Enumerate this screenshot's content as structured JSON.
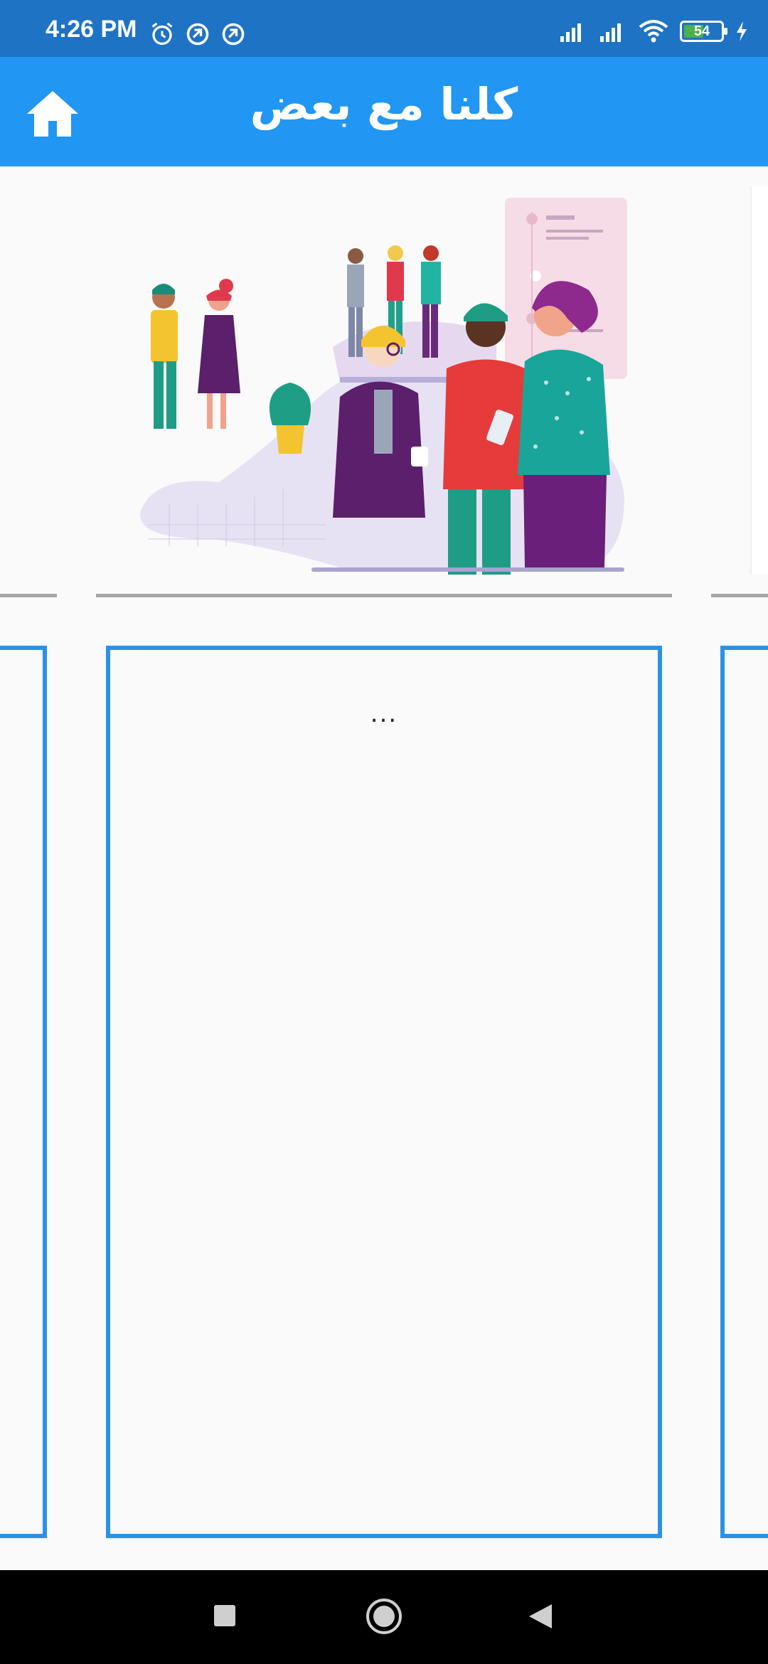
{
  "status_bar": {
    "time": "4:26 PM",
    "battery_level": "54",
    "battery_fraction": 0.54,
    "icons": [
      "alarm-icon",
      "sync-icon",
      "sync-icon",
      "signal-icon",
      "signal-icon",
      "wifi-icon",
      "battery-icon",
      "charging-icon"
    ]
  },
  "app_bar": {
    "title": "كلنا مع بعض",
    "home_icon": "home-icon"
  },
  "carousel": {
    "hero_image": "people-socializing-illustration",
    "center_card": {
      "text": "..."
    }
  },
  "nav_bar": {
    "buttons": [
      "recents-button",
      "home-button",
      "back-button"
    ]
  },
  "colors": {
    "status_bar": "#1e73c4",
    "app_bar": "#2196f3",
    "card_border": "#2c91e6",
    "background": "#fafafa"
  }
}
